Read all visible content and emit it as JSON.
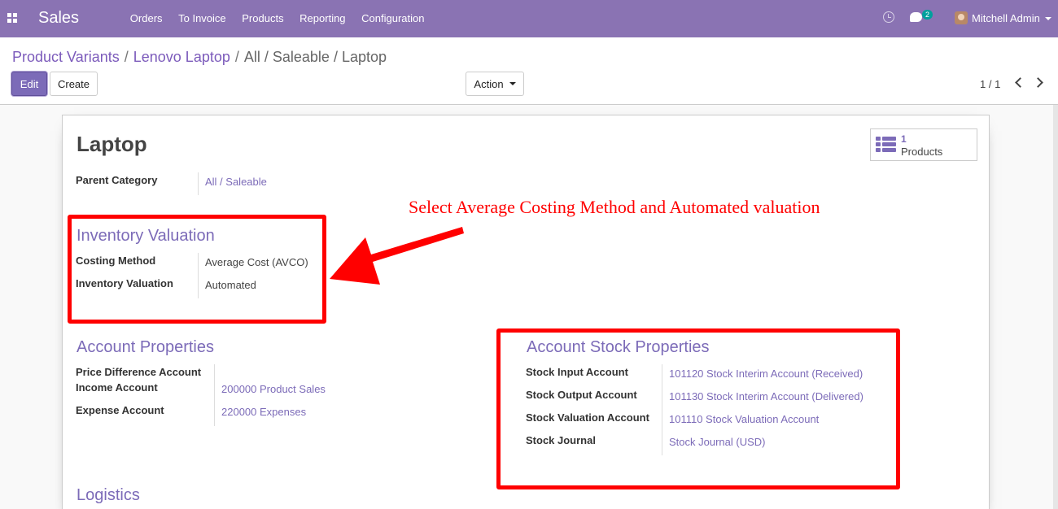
{
  "navbar": {
    "app_name": "Sales",
    "menu": [
      "Orders",
      "To Invoice",
      "Products",
      "Reporting",
      "Configuration"
    ],
    "chat_count": "2",
    "user_name": "Mitchell Admin"
  },
  "breadcrumb": {
    "parent1": "Product Variants",
    "parent2": "Lenovo Laptop",
    "current": "All / Saleable / Laptop",
    "separator": "/"
  },
  "buttons": {
    "edit": "Edit",
    "create": "Create",
    "action": "Action"
  },
  "pager": {
    "value": "1 / 1"
  },
  "record": {
    "title": "Laptop",
    "smart_button": {
      "count": "1",
      "label": "Products"
    },
    "parent_category": {
      "label": "Parent Category",
      "value": "All / Saleable"
    },
    "inventory_valuation": {
      "title": "Inventory Valuation",
      "costing_method_label": "Costing Method",
      "costing_method_value": "Average Cost (AVCO)",
      "valuation_label": "Inventory Valuation",
      "valuation_value": "Automated"
    },
    "account_properties": {
      "title": "Account Properties",
      "price_diff_label": "Price Difference Account",
      "income_label": "Income Account",
      "income_value": "200000 Product Sales",
      "expense_label": "Expense Account",
      "expense_value": "220000 Expenses"
    },
    "account_stock_properties": {
      "title": "Account Stock Properties",
      "input_label": "Stock Input Account",
      "input_value": "101120 Stock Interim Account (Received)",
      "output_label": "Stock Output Account",
      "output_value": "101130 Stock Interim Account (Delivered)",
      "valuation_label": "Stock Valuation Account",
      "valuation_value": "101110 Stock Valuation Account",
      "journal_label": "Stock Journal",
      "journal_value": "Stock Journal (USD)"
    },
    "logistics_title": "Logistics"
  },
  "annotation": {
    "text": "Select Average Costing Method and Automated valuation",
    "color": "#ff0000"
  },
  "colors": {
    "navbar": "#8a73b3",
    "accent": "#7c6bb8"
  },
  "icons": [
    "apps-icon",
    "clock-icon",
    "chat-icon",
    "caret-down-icon",
    "chevron-left-icon",
    "chevron-right-icon",
    "list-icon"
  ]
}
